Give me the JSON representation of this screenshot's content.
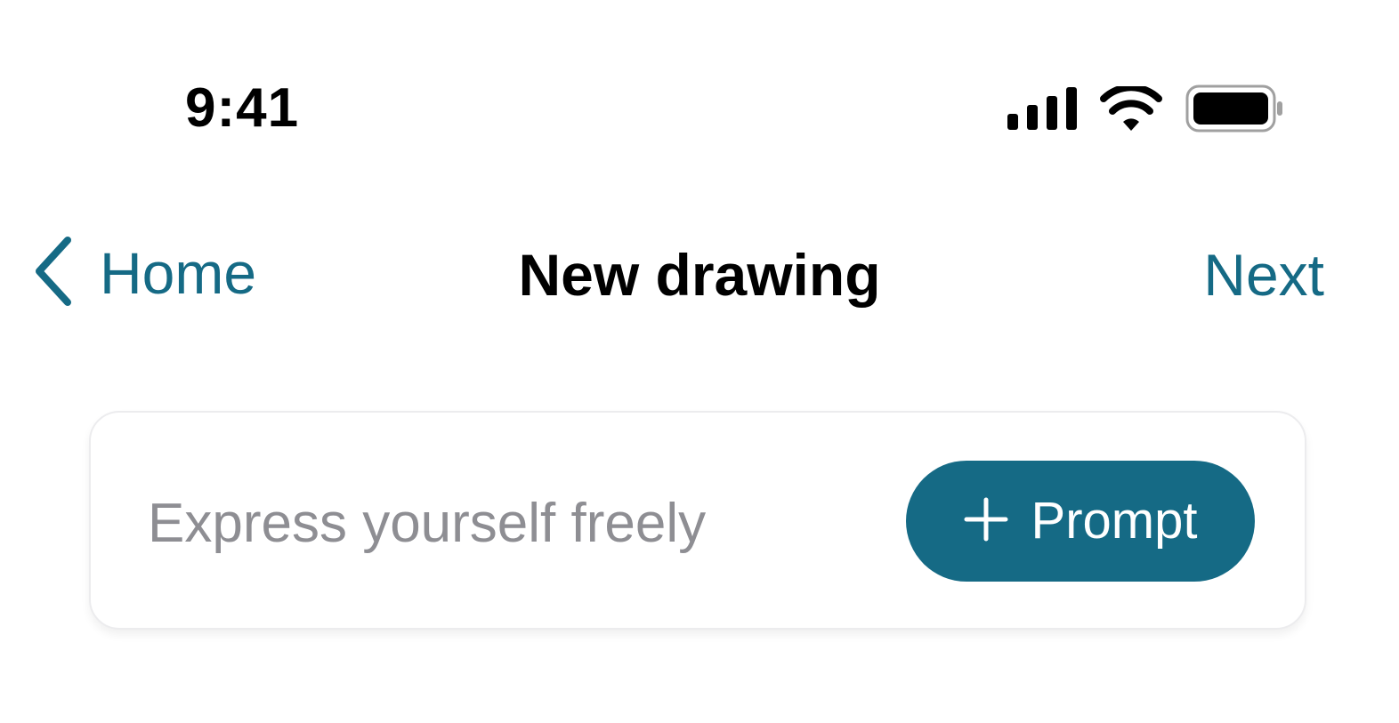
{
  "status_bar": {
    "time": "9:41",
    "icons": [
      "cellular-signal-icon",
      "wifi-icon",
      "battery-icon"
    ]
  },
  "nav": {
    "back_label": "Home",
    "title": "New drawing",
    "next_label": "Next",
    "accent_color": "#156a85"
  },
  "prompt_card": {
    "input_placeholder": "Express yourself freely",
    "input_value": "",
    "button_label": "Prompt",
    "button_icon": "plus-icon",
    "button_color": "#156a85"
  }
}
